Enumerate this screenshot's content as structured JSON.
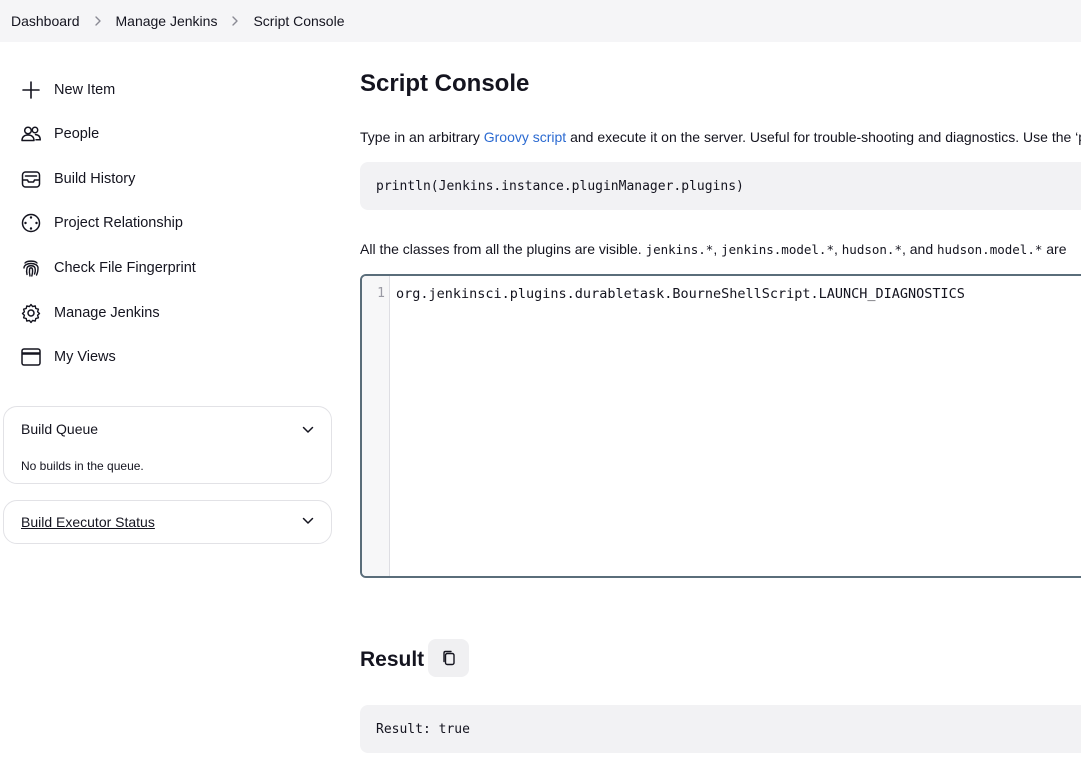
{
  "breadcrumb": {
    "items": [
      "Dashboard",
      "Manage Jenkins",
      "Script Console"
    ]
  },
  "sidebar": {
    "items": [
      {
        "label": "New Item",
        "icon": "plus-icon"
      },
      {
        "label": "People",
        "icon": "people-icon"
      },
      {
        "label": "Build History",
        "icon": "build-history-icon"
      },
      {
        "label": "Project Relationship",
        "icon": "relationship-icon"
      },
      {
        "label": "Check File Fingerprint",
        "icon": "fingerprint-icon"
      },
      {
        "label": "Manage Jenkins",
        "icon": "gear-icon"
      },
      {
        "label": "My Views",
        "icon": "window-icon"
      }
    ],
    "build_queue": {
      "title": "Build Queue",
      "empty_text": "No builds in the queue."
    },
    "executor_status": {
      "title": "Build Executor Status"
    }
  },
  "main": {
    "title": "Script Console",
    "description_prefix": "Type in an arbitrary ",
    "description_link": "Groovy script",
    "description_suffix": " and execute it on the server. Useful for trouble-shooting and diagnostics. Use the ‘p",
    "example_code": "println(Jenkins.instance.pluginManager.plugins)",
    "classes_text_prefix": "All the classes from all the plugins are visible. ",
    "classes_code_1": "jenkins.*",
    "classes_sep_1": ", ",
    "classes_code_2": "jenkins.model.*",
    "classes_sep_2": ", ",
    "classes_code_3": "hudson.*",
    "classes_sep_3": ", and ",
    "classes_code_4": "hudson.model.*",
    "classes_suffix": " are",
    "editor": {
      "line_number": "1",
      "code": "org.jenkinsci.plugins.durabletask.BourneShellScript.LAUNCH_DIAGNOSTICS"
    },
    "result_title": "Result",
    "result_text": "Result: true"
  },
  "colors": {
    "link": "#2b6ad1",
    "breadcrumb_bg": "#f5f5f7",
    "code_bg": "#f2f2f4",
    "editor_border": "#5a6d7a"
  }
}
